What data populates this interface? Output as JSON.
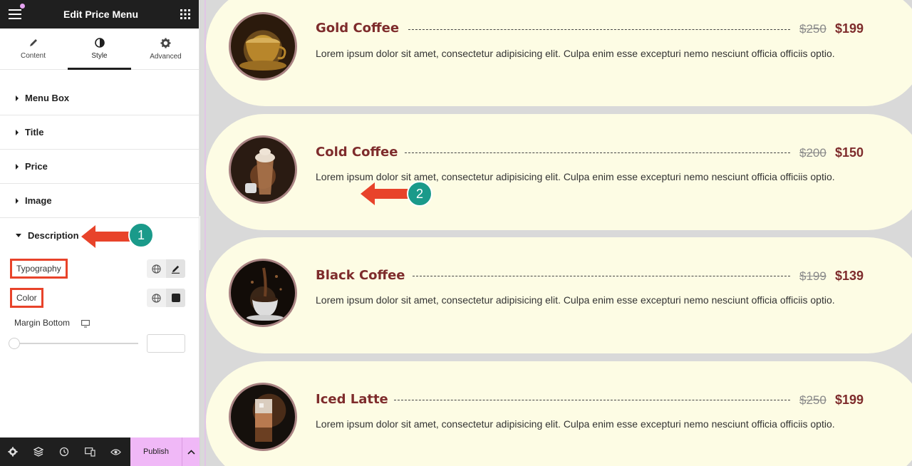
{
  "panel": {
    "title": "Edit Price Menu",
    "tabs": [
      {
        "label": "Content",
        "icon": "pencil-icon"
      },
      {
        "label": "Style",
        "icon": "contrast-icon"
      },
      {
        "label": "Advanced",
        "icon": "gear-icon"
      }
    ],
    "active_tab": "Style",
    "sections": [
      {
        "label": "Menu Box"
      },
      {
        "label": "Title"
      },
      {
        "label": "Price"
      },
      {
        "label": "Image"
      },
      {
        "label": "Description"
      }
    ],
    "open_section": "Description",
    "controls": {
      "typography_label": "Typography",
      "color_label": "Color",
      "margin_bottom_label": "Margin Bottom",
      "margin_bottom_value": ""
    },
    "bottom_bar": {
      "publish_label": "Publish",
      "icons": [
        "settings-icon",
        "layers-icon",
        "history-icon",
        "responsive-icon",
        "preview-eye-icon"
      ]
    }
  },
  "menu_items": [
    {
      "title": "Gold Coffee",
      "old_price": "$250",
      "price": "$199",
      "description": "Lorem ipsum dolor sit amet, consectetur adipisicing elit. Culpa enim esse excepturi nemo nesciunt officia officiis optio."
    },
    {
      "title": "Cold Coffee",
      "old_price": "$200",
      "price": "$150",
      "description": "Lorem ipsum dolor sit amet, consectetur adipisicing elit. Culpa enim esse excepturi nemo nesciunt officia officiis optio."
    },
    {
      "title": "Black Coffee",
      "old_price": "$199",
      "price": "$139",
      "description": "Lorem ipsum dolor sit amet, consectetur adipisicing elit. Culpa enim esse excepturi nemo nesciunt officia officiis optio."
    },
    {
      "title": "Iced Latte",
      "old_price": "$250",
      "price": "$199",
      "description": "Lorem ipsum dolor sit amet, consectetur adipisicing elit. Culpa enim esse excepturi nemo nesciunt officia officiis optio."
    }
  ],
  "annotations": {
    "badge_1": "1",
    "badge_2": "2"
  },
  "colors": {
    "accent_pink": "#f0b8f7",
    "title_maroon": "#7e2c2c",
    "card_cream": "#fdfce4",
    "highlight_red": "#e8432a",
    "badge_teal": "#1a9a8a"
  }
}
